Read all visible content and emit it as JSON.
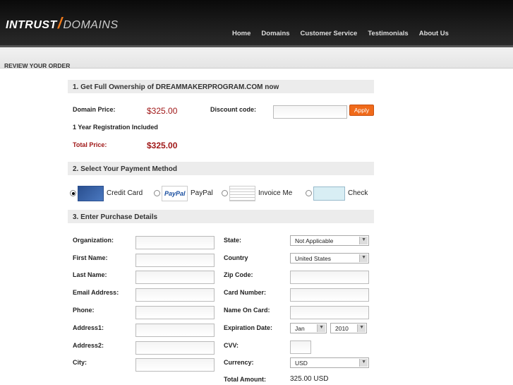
{
  "brand": {
    "left": "INTRUST",
    "right": "DOMAINS"
  },
  "nav": [
    "Home",
    "Domains",
    "Customer Service",
    "Testimonials",
    "About Us"
  ],
  "page_title": "REVIEW YOUR ORDER",
  "section1": {
    "title": "1. Get Full Ownership of DREAMMAKERPROGRAM.COM now",
    "domain_price_label": "Domain Price:",
    "domain_price": "$325.00",
    "discount_label": "Discount code:",
    "discount_value": "",
    "apply": "Apply",
    "registration_note": "1 Year Registration Included",
    "total_label": "Total Price:",
    "total": "$325.00"
  },
  "section2": {
    "title": "2. Select Your Payment Method",
    "methods": [
      {
        "label": "Credit Card",
        "icon": "credit-card-icon",
        "selected": true
      },
      {
        "label": "PayPal",
        "icon": "paypal-icon",
        "logo_text": "PayPal"
      },
      {
        "label": "Invoice Me",
        "icon": "invoice-icon"
      },
      {
        "label": "Check",
        "icon": "check-icon"
      }
    ]
  },
  "section3": {
    "title": "3. Enter Purchase Details",
    "left": [
      {
        "label": "Organization:",
        "value": ""
      },
      {
        "label": "First Name:",
        "value": ""
      },
      {
        "label": "Last Name:",
        "value": ""
      },
      {
        "label": "Email Address:",
        "value": ""
      },
      {
        "label": "Phone:",
        "value": ""
      },
      {
        "label": "Address1:",
        "value": ""
      },
      {
        "label": "Address2:",
        "value": ""
      },
      {
        "label": "City:",
        "value": ""
      }
    ],
    "state": {
      "label": "State:",
      "value": "Not Applicable"
    },
    "country": {
      "label": "Country",
      "value": "United States"
    },
    "zip": {
      "label": "Zip Code:",
      "value": ""
    },
    "card_number": {
      "label": "Card Number:",
      "value": ""
    },
    "name_on_card": {
      "label": "Name On Card:",
      "value": ""
    },
    "expiration": {
      "label": "Expiration Date:",
      "month": "Jan",
      "year": "2010"
    },
    "cvv": {
      "label": "CVV:",
      "value": ""
    },
    "currency": {
      "label": "Currency:",
      "value": "USD"
    },
    "total": {
      "label": "Total Amount:",
      "value": "325.00 USD"
    }
  }
}
